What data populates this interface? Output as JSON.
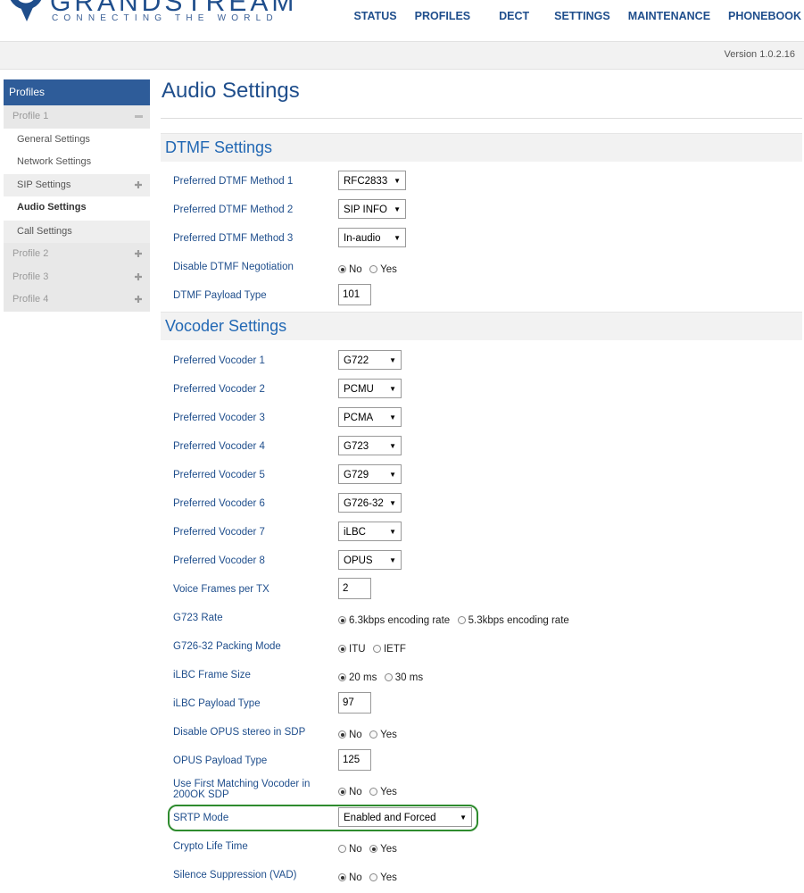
{
  "header": {
    "brand": "GRANDSTREAM",
    "tagline": "CONNECTING THE WORLD",
    "nav": [
      "STATUS",
      "PROFILES",
      "DECT",
      "SETTINGS",
      "MAINTENANCE",
      "PHONEBOOK"
    ],
    "version": "Version 1.0.2.16"
  },
  "sidebar": {
    "title": "Profiles",
    "profile1": "Profile 1",
    "sub": [
      "General Settings",
      "Network Settings",
      "SIP Settings",
      "Audio Settings",
      "Call Settings"
    ],
    "profiles": [
      "Profile 2",
      "Profile 3",
      "Profile 4"
    ]
  },
  "page": {
    "title": "Audio Settings",
    "dtmf_title": "DTMF Settings",
    "vocoder_title": "Vocoder Settings"
  },
  "dtmf": {
    "m1_label": "Preferred DTMF Method 1",
    "m1": "RFC2833",
    "m2_label": "Preferred DTMF Method 2",
    "m2": "SIP INFO",
    "m3_label": "Preferred DTMF Method 3",
    "m3": "In-audio",
    "neg_label": "Disable DTMF Negotiation",
    "payload_label": "DTMF Payload Type",
    "payload": "101"
  },
  "vocoder": {
    "v1_label": "Preferred Vocoder 1",
    "v1": "G722",
    "v2_label": "Preferred Vocoder 2",
    "v2": "PCMU",
    "v3_label": "Preferred Vocoder 3",
    "v3": "PCMA",
    "v4_label": "Preferred Vocoder 4",
    "v4": "G723",
    "v5_label": "Preferred Vocoder 5",
    "v5": "G729",
    "v6_label": "Preferred Vocoder 6",
    "v6": "G726-32",
    "v7_label": "Preferred Vocoder 7",
    "v7": "iLBC",
    "v8_label": "Preferred Vocoder 8",
    "v8": "OPUS",
    "vf_label": "Voice Frames per TX",
    "vf": "2",
    "g723_label": "G723 Rate",
    "g723_a": "6.3kbps encoding rate",
    "g723_b": "5.3kbps encoding rate",
    "g726_label": "G726-32 Packing Mode",
    "g726_a": "ITU",
    "g726_b": "IETF",
    "ilbc_fs_label": "iLBC Frame Size",
    "ilbc_a": "20 ms",
    "ilbc_b": "30 ms",
    "ilbc_pt_label": "iLBC Payload Type",
    "ilbc_pt": "97",
    "opus_stereo_label": "Disable OPUS stereo in SDP",
    "opus_pt_label": "OPUS Payload Type",
    "opus_pt": "125",
    "first_match_label": "Use First Matching Vocoder in 200OK SDP",
    "srtp_label": "SRTP Mode",
    "srtp": "Enabled and Forced",
    "crypto_label": "Crypto Life Time",
    "silence_label": "Silence Suppression (VAD)"
  },
  "common": {
    "no": "No",
    "yes": "Yes"
  }
}
